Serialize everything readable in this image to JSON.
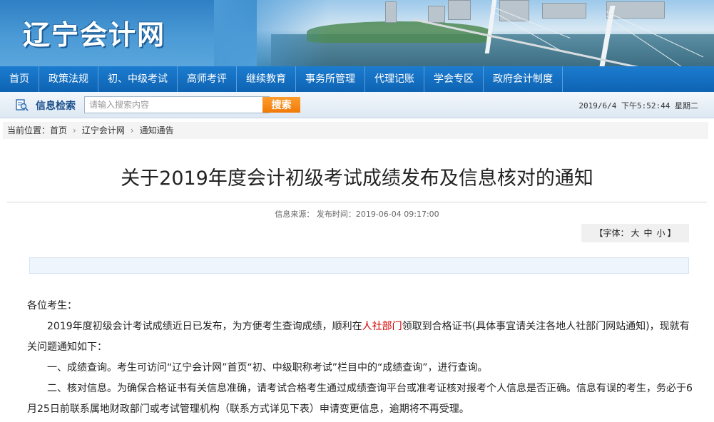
{
  "site": {
    "logo": "辽宁会计网"
  },
  "nav": [
    "首页",
    "政策法规",
    "初、中级考试",
    "高师考评",
    "继续教育",
    "事务所管理",
    "代理记账",
    "学会专区",
    "政府会计制度"
  ],
  "search": {
    "label": "信息检索",
    "placeholder": "请输入搜索内容",
    "button": "搜索",
    "datetime": "2019/6/4  下午5:52:44  星期二"
  },
  "breadcrumb": {
    "prefix": "当前位置：",
    "items": [
      "首页",
      "辽宁会计网",
      "通知通告"
    ]
  },
  "article": {
    "title": "关于2019年度会计初级考试成绩发布及信息核对的通知",
    "meta": "信息来源：  发布时间：2019-06-04 09:17:00",
    "font_control": {
      "prefix": "【字体：",
      "large": "大",
      "medium": "中",
      "small": "小",
      "suffix": "】"
    },
    "greeting": "各位考生：",
    "para1_a": "2019年度初级会计考试成绩近日已发布，为方便考生查询成绩，顺利在",
    "para1_link": "人社部门",
    "para1_b": "领取到合格证书(具体事宜请关注各地人社部门网站通知)，现就有关问题通知如下：",
    "para2": "一、成绩查询。考生可访问“辽宁会计网”首页“初、中级职称考试”栏目中的“成绩查询”，进行查询。",
    "para3": "二、核对信息。为确保合格证书有关信息准确，请考试合格考生通过成绩查询平台或准考证核对报考个人信息是否正确。信息有误的考生，务必于6月25日前联系属地财政部门或考试管理机构（联系方式详见下表）申请变更信息，逾期将不再受理。"
  },
  "colors": {
    "nav": "#0e63b3",
    "search_button": "#f07a08",
    "link": "#d40000"
  }
}
